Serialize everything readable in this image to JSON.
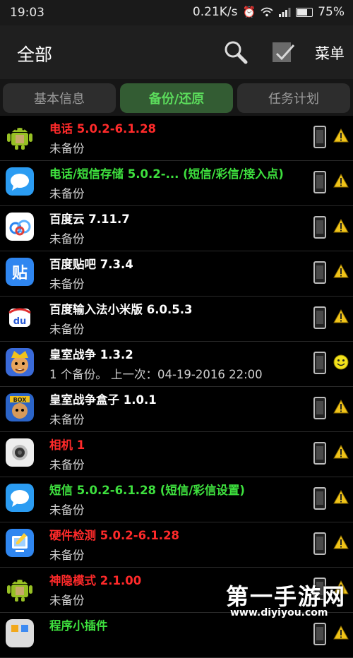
{
  "statusbar": {
    "time": "19:03",
    "speed": "0.21K/s",
    "battery": "75%",
    "battery_level": 0.75,
    "icons": [
      "alarm-icon",
      "wifi-icon",
      "signal-icon",
      "battery-icon"
    ]
  },
  "toolbar": {
    "title": "全部",
    "menu_label": "菜单",
    "icons": [
      "search-icon",
      "check-all-icon"
    ]
  },
  "tabs": [
    {
      "label": "基本信息",
      "active": false
    },
    {
      "label": "备份/还原",
      "active": true
    },
    {
      "label": "任务计划",
      "active": false
    }
  ],
  "apps": [
    {
      "name": "电话 5.0.2-6.1.28",
      "name_color": "red",
      "sub": "未备份",
      "icon": "android-icon",
      "status": "warning"
    },
    {
      "name": "电话/短信存储 5.0.2-... (短信/彩信/接入点)",
      "name_color": "green",
      "sub": "未备份",
      "icon": "message-icon",
      "status": "warning"
    },
    {
      "name": "百度云 7.11.7",
      "name_color": "white",
      "sub": "未备份",
      "icon": "baidu-cloud-icon",
      "status": "warning"
    },
    {
      "name": "百度贴吧 7.3.4",
      "name_color": "white",
      "sub": "未备份",
      "icon": "tieba-icon",
      "status": "warning"
    },
    {
      "name": "百度输入法小米版 6.0.5.3",
      "name_color": "white",
      "sub": "未备份",
      "icon": "baidu-input-icon",
      "status": "warning"
    },
    {
      "name": "皇室战争 1.3.2",
      "name_color": "white",
      "sub": "1 个备份。 上一次：04-19-2016 22:00",
      "icon": "clash-royale-icon",
      "status": "ok"
    },
    {
      "name": "皇室战争盒子 1.0.1",
      "name_color": "white",
      "sub": "未备份",
      "icon": "game-box-icon",
      "status": "warning"
    },
    {
      "name": "相机 1",
      "name_color": "red",
      "sub": "未备份",
      "icon": "camera-icon",
      "status": "warning"
    },
    {
      "name": "短信 5.0.2-6.1.28 (短信/彩信设置)",
      "name_color": "green",
      "sub": "未备份",
      "icon": "sms-icon",
      "status": "warning"
    },
    {
      "name": "硬件检测 5.0.2-6.1.28",
      "name_color": "red",
      "sub": "未备份",
      "icon": "hardware-test-icon",
      "status": "warning"
    },
    {
      "name": "神隐模式 2.1.00",
      "name_color": "red",
      "sub": "未备份",
      "icon": "android-icon",
      "status": "warning"
    },
    {
      "name": "程序小插件",
      "name_color": "green",
      "sub": "",
      "icon": "widget-icon",
      "status": "warning"
    }
  ],
  "watermark": {
    "text": "第一手游网",
    "url": "www.diyiyou.com"
  }
}
